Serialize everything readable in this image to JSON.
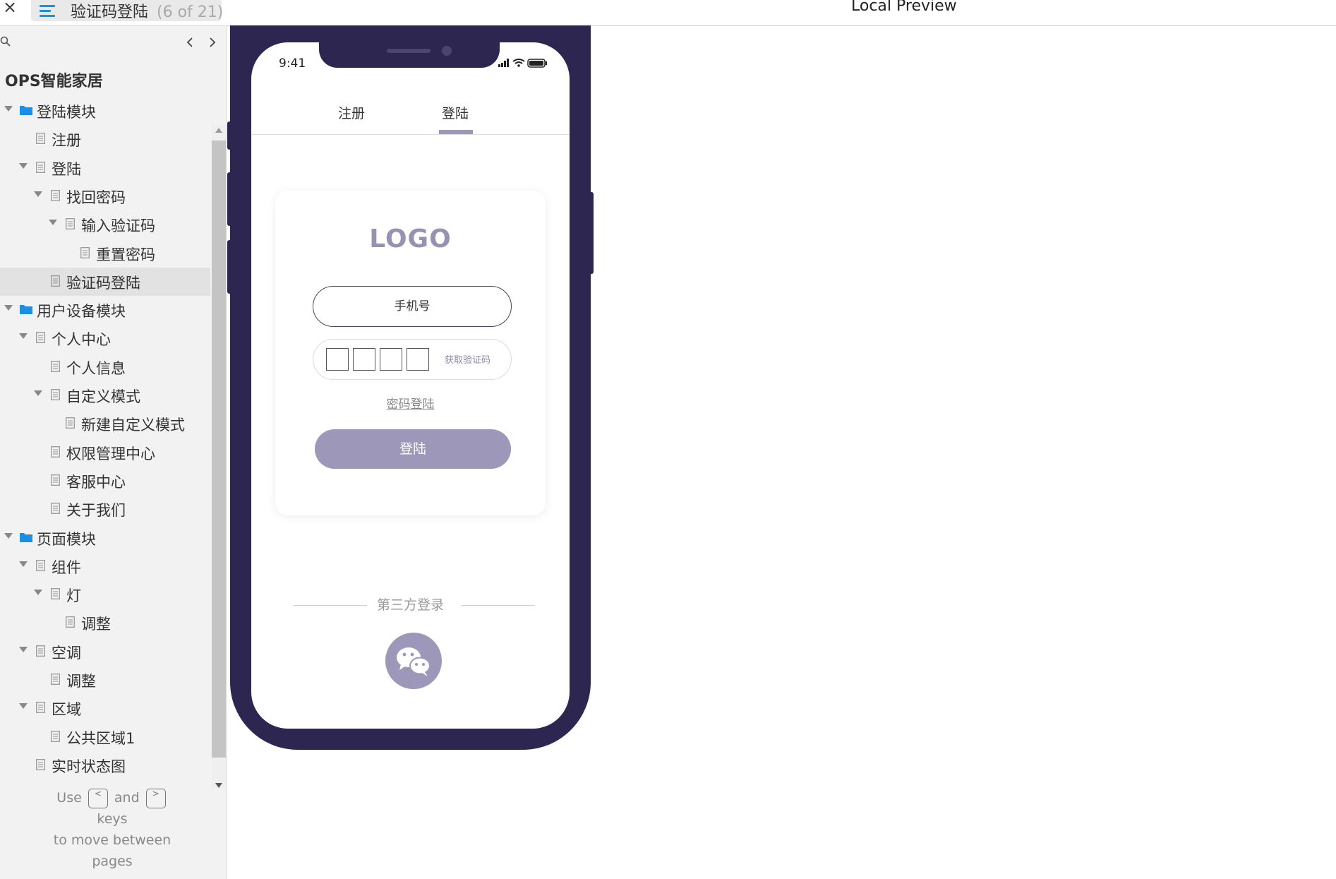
{
  "topbar": {
    "close_glyph": "×",
    "tab_title": "验证码登陆",
    "tab_count": "(6 of 21)",
    "preview_title": "Local Preview"
  },
  "sidebar": {
    "project_title": "OPS智能家居",
    "tree": [
      {
        "label": "登陆模块",
        "type": "folder",
        "level": 0,
        "expanded": true
      },
      {
        "label": "注册",
        "type": "page",
        "level": 1,
        "expanded": false
      },
      {
        "label": "登陆",
        "type": "page",
        "level": 1,
        "expanded": true
      },
      {
        "label": "找回密码",
        "type": "page",
        "level": 2,
        "expanded": true
      },
      {
        "label": "输入验证码",
        "type": "page",
        "level": 3,
        "expanded": true
      },
      {
        "label": "重置密码",
        "type": "page",
        "level": 4,
        "expanded": false
      },
      {
        "label": "验证码登陆",
        "type": "page",
        "level": 2,
        "expanded": false,
        "selected": true
      },
      {
        "label": "用户设备模块",
        "type": "folder",
        "level": 0,
        "expanded": true
      },
      {
        "label": "个人中心",
        "type": "page",
        "level": 1,
        "expanded": true
      },
      {
        "label": "个人信息",
        "type": "page",
        "level": 2,
        "expanded": false
      },
      {
        "label": "自定义模式",
        "type": "page",
        "level": 2,
        "expanded": true
      },
      {
        "label": "新建自定义模式",
        "type": "page",
        "level": 3,
        "expanded": false
      },
      {
        "label": "权限管理中心",
        "type": "page",
        "level": 2,
        "expanded": false
      },
      {
        "label": "客服中心",
        "type": "page",
        "level": 2,
        "expanded": false
      },
      {
        "label": "关于我们",
        "type": "page",
        "level": 2,
        "expanded": false
      },
      {
        "label": "页面模块",
        "type": "folder",
        "level": 0,
        "expanded": true
      },
      {
        "label": "组件",
        "type": "page",
        "level": 1,
        "expanded": true
      },
      {
        "label": "灯",
        "type": "page",
        "level": 2,
        "expanded": true
      },
      {
        "label": "调整",
        "type": "page",
        "level": 3,
        "expanded": false
      },
      {
        "label": "空调",
        "type": "page",
        "level": 1,
        "expanded": true
      },
      {
        "label": "调整",
        "type": "page",
        "level": 2,
        "expanded": false
      },
      {
        "label": "区域",
        "type": "page",
        "level": 1,
        "expanded": true
      },
      {
        "label": "公共区域1",
        "type": "page",
        "level": 2,
        "expanded": false
      },
      {
        "label": "实时状态图",
        "type": "page",
        "level": 1,
        "expanded": false
      }
    ],
    "hint": {
      "use": "Use",
      "and": "and",
      "keys": "keys",
      "line3": "to move between",
      "line4": "pages",
      "prev_key": "<",
      "next_key": ">"
    },
    "accent_color": "#1a8fe3"
  },
  "phone": {
    "time": "9:41",
    "tabs": {
      "register": "注册",
      "login": "登陆"
    },
    "logo": "LOGO",
    "phone_placeholder": "手机号",
    "get_code": "获取验证码",
    "password_login": "密码登陆",
    "login_button": "登陆",
    "third_party": "第三方登录",
    "frame_color": "#2d2651",
    "accent_color": "#9d97b9"
  }
}
